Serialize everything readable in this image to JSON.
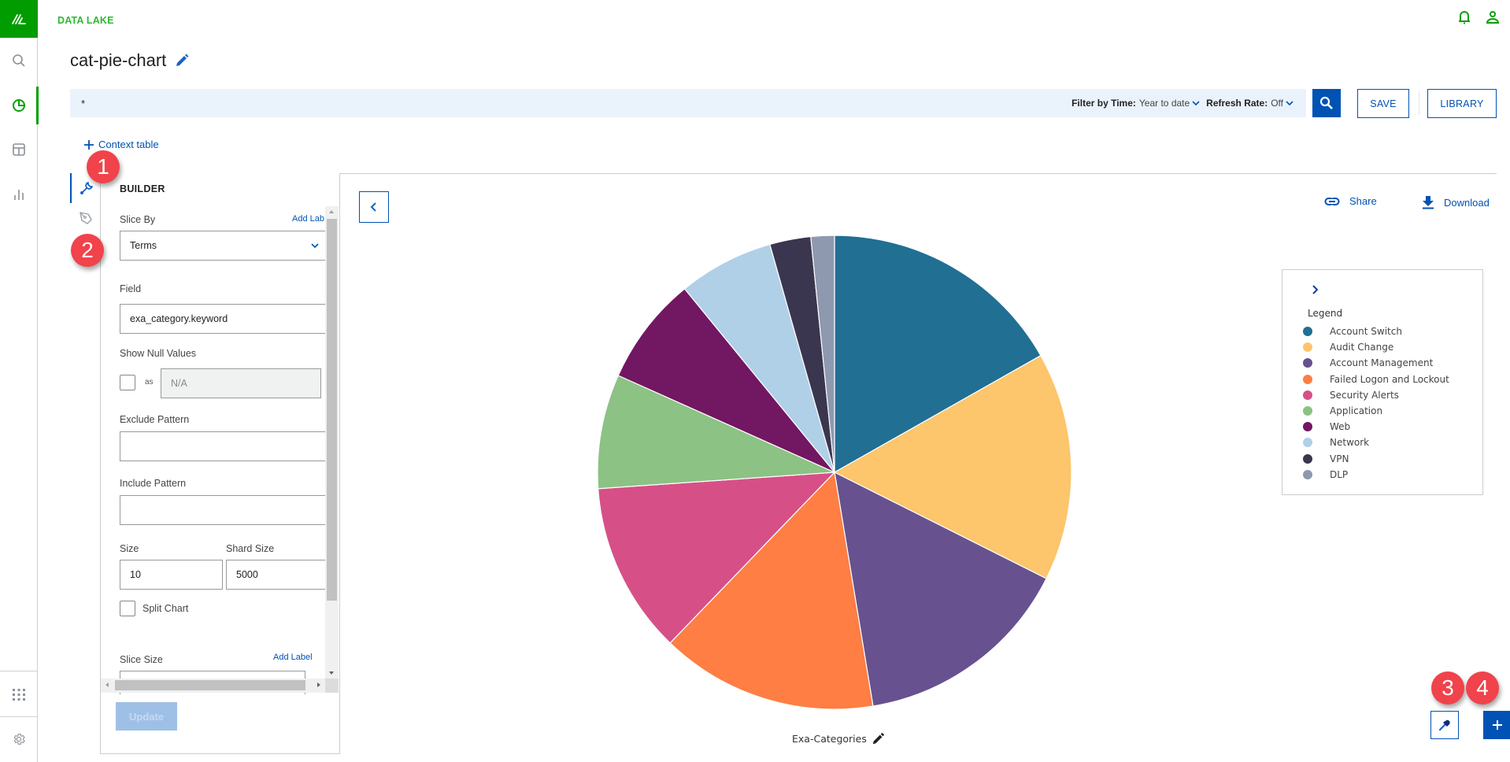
{
  "app": {
    "name": "DATA LAKE",
    "page_title": "cat-pie-chart"
  },
  "rail": {
    "items": [
      {
        "name": "search",
        "icon": "search-icon",
        "active": false
      },
      {
        "name": "visualize",
        "icon": "pie-chart-icon",
        "active": true
      },
      {
        "name": "dashboards",
        "icon": "layout-icon",
        "active": false
      },
      {
        "name": "reports",
        "icon": "bar-chart-icon",
        "active": false
      }
    ],
    "bottom": [
      {
        "name": "apps",
        "icon": "apps-grid-icon"
      },
      {
        "name": "settings",
        "icon": "gear-icon"
      }
    ]
  },
  "header": {
    "icons": [
      "bell-icon",
      "user-icon"
    ],
    "accent": "#009c00"
  },
  "search": {
    "query": "*",
    "filter_time_label": "Filter by Time:",
    "filter_time_value": "Year to date",
    "refresh_label": "Refresh Rate:",
    "refresh_value": "Off",
    "save_label": "SAVE",
    "library_label": "LIBRARY"
  },
  "context_table": {
    "label": "Context table"
  },
  "builder": {
    "title": "BUILDER",
    "slice_by_label": "Slice By",
    "slice_by_add_label": "Add Lab",
    "slice_by_value": "Terms",
    "field_label": "Field",
    "field_value": "exa_category.keyword",
    "show_null_label": "Show Null Values",
    "show_null_checked": false,
    "as_label": "as",
    "null_placeholder": "N/A",
    "exclude_label": "Exclude Pattern",
    "exclude_value": "",
    "include_label": "Include Pattern",
    "include_value": "",
    "size_label": "Size",
    "size_value": "10",
    "shard_size_label": "Shard Size",
    "shard_size_value": "5000",
    "split_chart_label": "Split Chart",
    "split_chart_checked": false,
    "slice_size_label": "Slice Size",
    "slice_size_add_label": "Add Label",
    "update_label": "Update"
  },
  "chart_actions": {
    "share_label": "Share",
    "download_label": "Download"
  },
  "legend": {
    "title": "Legend"
  },
  "chart_label": "Exa-Categories",
  "badges": [
    "1",
    "2",
    "3",
    "4"
  ],
  "chart_data": {
    "type": "pie",
    "title": "Exa-Categories",
    "legend_position": "right",
    "categories": [
      "Account Switch",
      "Audit Change",
      "Account Management",
      "Failed Logon and Lockout",
      "Security Alerts",
      "Application",
      "Web",
      "Network",
      "VPN",
      "DLP"
    ],
    "values": [
      16.8,
      15.6,
      15.0,
      14.8,
      11.7,
      7.8,
      7.4,
      6.5,
      2.8,
      1.6
    ],
    "value_unit": "percent (estimated)",
    "colors": [
      "#216f93",
      "#fdc56c",
      "#67518f",
      "#fe7e44",
      "#d65087",
      "#8cc284",
      "#721762",
      "#b0d0e8",
      "#3b364f",
      "#8e99af"
    ]
  }
}
